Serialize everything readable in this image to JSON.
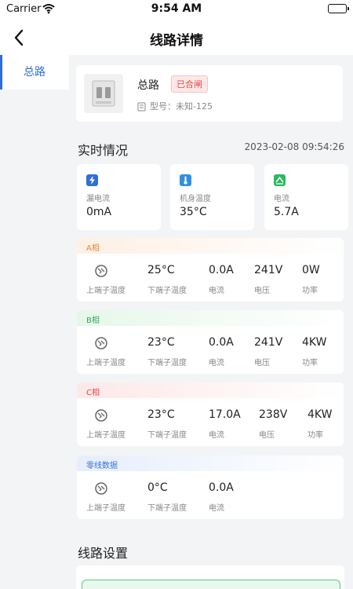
{
  "status_bar": {
    "carrier": "Carrier",
    "time": "9:54 AM"
  },
  "nav": {
    "title": "线路详情"
  },
  "sidebar": {
    "items": [
      {
        "label": "总路"
      }
    ]
  },
  "device": {
    "name": "总路",
    "status_badge": "已合闸",
    "model": "型号：未知-125"
  },
  "realtime": {
    "title": "实时情况",
    "timestamp": "2023-02-08 09:54:26",
    "metrics": [
      {
        "label": "漏电流",
        "value": "0mA",
        "icon": "lightning-icon",
        "color": "#2f6fd6"
      },
      {
        "label": "机身温度",
        "value": "35°C",
        "icon": "thermometer-icon",
        "color": "#2f8fe0"
      },
      {
        "label": "电流",
        "value": "5.7A",
        "icon": "current-icon",
        "color": "#2db860"
      }
    ]
  },
  "phases": [
    {
      "name": "A相",
      "values": [
        "25°C",
        "0.0A",
        "241V",
        "0W"
      ],
      "labels": [
        "上端子温度",
        "下端子温度",
        "电流",
        "电压",
        "功率"
      ]
    },
    {
      "name": "B相",
      "values": [
        "23°C",
        "0.0A",
        "241V",
        "4KW"
      ],
      "labels": [
        "上端子温度",
        "下端子温度",
        "电流",
        "电压",
        "功率"
      ]
    },
    {
      "name": "C相",
      "values": [
        "23°C",
        "17.0A",
        "238V",
        "4KW"
      ],
      "labels": [
        "上端子温度",
        "下端子温度",
        "电流",
        "电压",
        "功率"
      ]
    },
    {
      "name": "零线数据",
      "values": [
        "0°C",
        "0.0A"
      ],
      "labels": [
        "上端子温度",
        "下端子温度",
        "电流"
      ]
    }
  ],
  "settings": {
    "title": "线路设置"
  },
  "colors": {
    "accent": "#2f6fd6",
    "closed_badge": "#e04a4a",
    "phase_a": "#e08a3a",
    "phase_b": "#33a85a",
    "phase_c": "#e04a4a",
    "neutral": "#3a70d8"
  }
}
